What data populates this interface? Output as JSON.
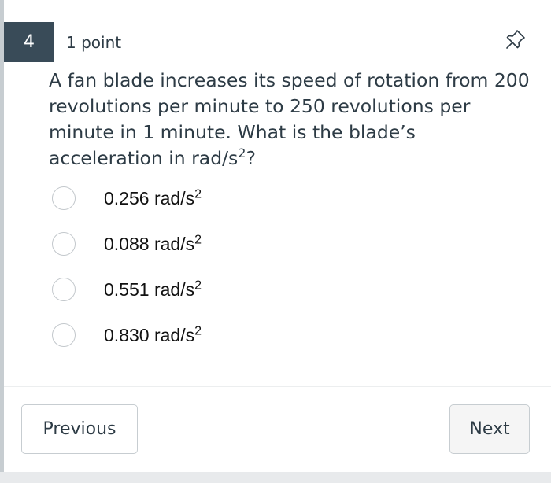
{
  "question": {
    "number": "4",
    "points": "1 point",
    "text_main": "A fan blade increases its speed of rotation from 200 revolutions per minute to 250 revolutions per minute in 1 minute. What is the blade’s acceleration in rad/s",
    "text_sup": "2",
    "text_end": "?",
    "options": [
      {
        "value": "0.256 rad/s",
        "sup": "2",
        "selected": false
      },
      {
        "value": "0.088 rad/s",
        "sup": "2",
        "selected": false
      },
      {
        "value": "0.551 rad/s",
        "sup": "2",
        "selected": false
      },
      {
        "value": "0.830 rad/s",
        "sup": "2",
        "selected": false
      }
    ]
  },
  "navigation": {
    "previous_label": "Previous",
    "next_label": "Next"
  },
  "icons": {
    "pin": "pin-icon",
    "radio": "radio-button"
  },
  "colors": {
    "question_number_bg": "#394b58",
    "text": "#2d3b45",
    "radio_border": "#c3c8cc",
    "button_border": "#c7cdd1",
    "next_button_bg": "#f5f5f5"
  }
}
